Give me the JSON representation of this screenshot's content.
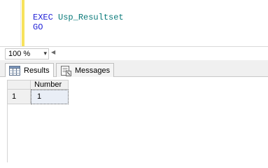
{
  "editor": {
    "lines": [
      {
        "keyword": "EXEC",
        "identifier": "Usp_Resultset"
      },
      {
        "keyword": "GO",
        "identifier": ""
      }
    ]
  },
  "zoom": {
    "value": "100 %",
    "arrow": "▾",
    "scroll_arrow": "◀"
  },
  "tabs": [
    {
      "label": "Results",
      "icon": "results-grid-icon",
      "active": true
    },
    {
      "label": "Messages",
      "icon": "messages-icon",
      "active": false
    }
  ],
  "results_grid": {
    "columns": [
      "Number"
    ],
    "rows": [
      {
        "row_number": "1",
        "cells": [
          "1"
        ]
      }
    ]
  },
  "colors": {
    "keyword": "#1f1fd6",
    "identifier": "#0a7a7a",
    "change_bar": "#f7e25d",
    "selected_cell": "#e9eef6"
  }
}
